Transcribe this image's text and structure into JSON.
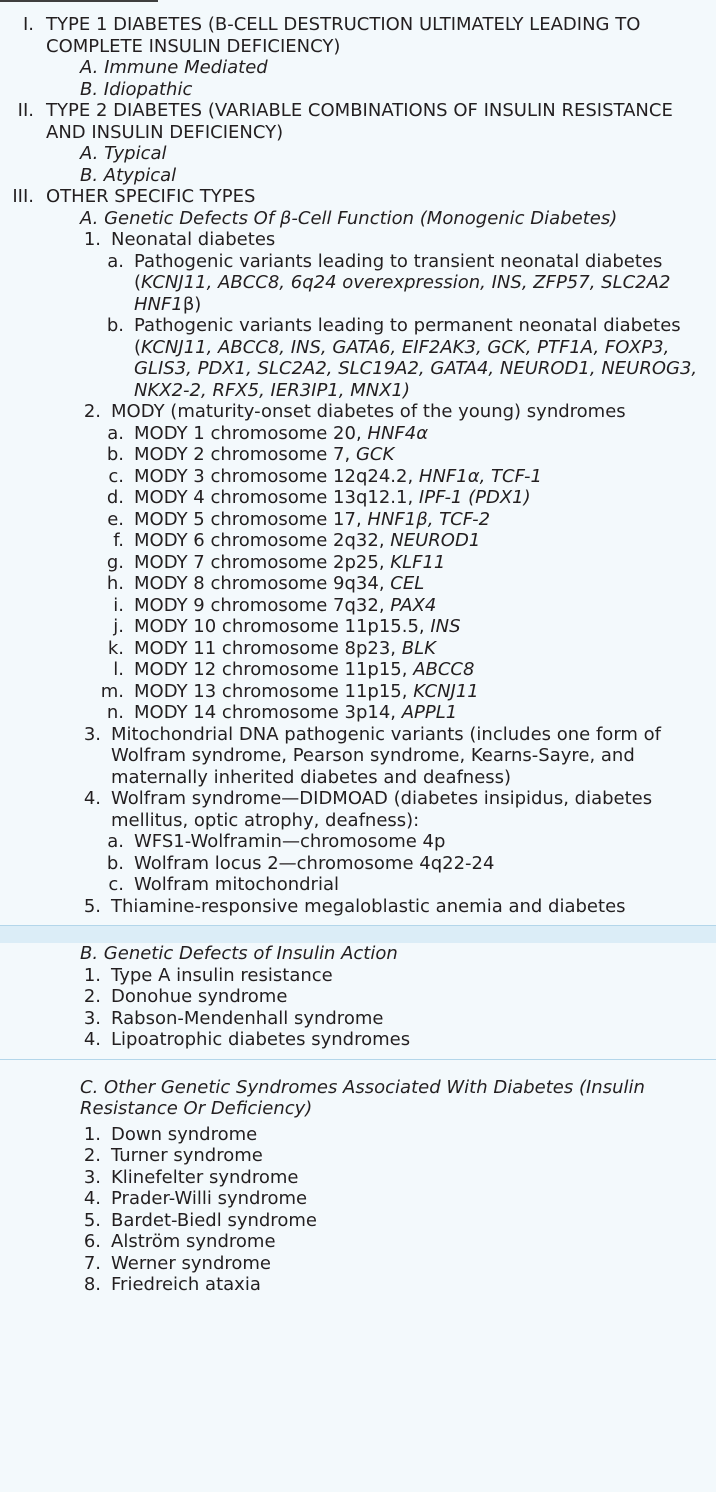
{
  "sections": [
    {
      "type": "roman",
      "marker": "I.",
      "text": "TYPE 1 DIABETES (Β-CELL DESTRUCTION ULTIMATELY LEADING TO COMPLETE INSULIN DEFICIENCY)",
      "items": [
        "A. Immune Mediated",
        "B. Idiopathic"
      ]
    },
    {
      "type": "roman",
      "marker": "II.",
      "text": "TYPE 2 DIABETES (VARIABLE COMBINATIONS OF INSULIN RESISTANCE AND INSULIN DEFICIENCY)",
      "items": [
        "A. Typical",
        "B. Atypical"
      ]
    },
    {
      "type": "roman",
      "marker": "III.",
      "text": "OTHER SPECIFIC TYPES",
      "items": []
    }
  ],
  "subsection_a": {
    "title": "A. Genetic Defects Of β-Cell Function (Monogenic Diabetes)",
    "neonatal": {
      "marker": "1.",
      "text": "Neonatal diabetes",
      "transient": {
        "marker": "a.",
        "plain": "Pathogenic variants leading to transient neonatal diabetes (",
        "genes": "KCNJ11, ABCC8, 6q24 overexpression, INS, ZFP57, SLC2A2 HNF1",
        "tail": "β)"
      },
      "permanent": {
        "marker": "b.",
        "plain": "Pathogenic variants leading to permanent neonatal diabetes (",
        "genes": "KCNJ11, ABCC8, INS, GATA6, EIF2AK3, GCK, PTF1A, FOXP3, GLIS3, PDX1, SLC2A2, SLC19A2, GATA4, NEUROD1, NEUROG3, NKX2-2, RFX5, IER3IP1, MNX1)"
      }
    },
    "mody": {
      "marker": "2.",
      "text": "MODY (maturity-onset diabetes of the young) syndromes",
      "items": [
        {
          "marker": "a.",
          "plain": "MODY 1 chromosome 20, ",
          "genes": "HNF4α"
        },
        {
          "marker": "b.",
          "plain": "MODY 2 chromosome 7, ",
          "genes": "GCK"
        },
        {
          "marker": "c.",
          "plain": "MODY 3 chromosome 12q24.2, ",
          "genes": "HNF1α, TCF-1"
        },
        {
          "marker": "d.",
          "plain": "MODY 4 chromosome 13q12.1, ",
          "genes": "IPF-1 (PDX1)"
        },
        {
          "marker": "e.",
          "plain": "MODY 5 chromosome 17, ",
          "genes": "HNF1β, TCF-2"
        },
        {
          "marker": "f.",
          "plain": "MODY 6 chromosome 2q32, ",
          "genes": "NEUROD1"
        },
        {
          "marker": "g.",
          "plain": "MODY 7 chromosome 2p25, ",
          "genes": "KLF11"
        },
        {
          "marker": "h.",
          "plain": "MODY 8 chromosome 9q34, ",
          "genes": "CEL"
        },
        {
          "marker": "i.",
          "plain": "MODY 9 chromosome 7q32, ",
          "genes": "PAX4"
        },
        {
          "marker": "j.",
          "plain": "MODY 10 chromosome 11p15.5, ",
          "genes": "INS"
        },
        {
          "marker": "k.",
          "plain": "MODY 11 chromosome 8p23, ",
          "genes": "BLK"
        },
        {
          "marker": "l.",
          "plain": "MODY 12 chromosome 11p15, ",
          "genes": "ABCC8"
        },
        {
          "marker": "m.",
          "plain": "MODY 13 chromosome 11p15, ",
          "genes": "KCNJ11"
        },
        {
          "marker": "n.",
          "plain": "MODY 14 chromosome 3p14, ",
          "genes": "APPL1"
        }
      ]
    },
    "mito": {
      "marker": "3.",
      "text": "Mitochondrial DNA pathogenic variants (includes one form of Wolfram syndrome, Pearson syndrome, Kearns-Sayre, and maternally inherited diabetes and deafness)"
    },
    "wolfram": {
      "marker": "4.",
      "text": "Wolfram syndrome—DIDMOAD (diabetes insipidus, diabetes mellitus, optic atrophy, deafness):",
      "items": [
        {
          "marker": "a.",
          "text": "WFS1-Wolframin—chromosome 4p"
        },
        {
          "marker": "b.",
          "text": "Wolfram locus 2—chromosome 4q22-24"
        },
        {
          "marker": "c.",
          "text": "Wolfram mitochondrial"
        }
      ]
    },
    "thiamine": {
      "marker": "5.",
      "text": "Thiamine-responsive megaloblastic anemia and diabetes"
    }
  },
  "subsection_b": {
    "title": "B. Genetic Defects of Insulin Action",
    "items": [
      {
        "marker": "1.",
        "text": "Type A insulin resistance"
      },
      {
        "marker": "2.",
        "text": "Donohue syndrome"
      },
      {
        "marker": "3.",
        "text": "Rabson-Mendenhall syndrome"
      },
      {
        "marker": "4.",
        "text": "Lipoatrophic diabetes syndromes"
      }
    ]
  },
  "subsection_c": {
    "title": "C. Other Genetic Syndromes Associated With Diabetes (Insulin Resistance Or Deficiency)",
    "items": [
      {
        "marker": "1.",
        "text": "Down syndrome"
      },
      {
        "marker": "2.",
        "text": "Turner syndrome"
      },
      {
        "marker": "3.",
        "text": "Klinefelter syndrome"
      },
      {
        "marker": "4.",
        "text": "Prader-Willi syndrome"
      },
      {
        "marker": "5.",
        "text": "Bardet-Biedl syndrome"
      },
      {
        "marker": "6.",
        "text": "Alström syndrome"
      },
      {
        "marker": "7.",
        "text": "Werner syndrome"
      },
      {
        "marker": "8.",
        "text": "Friedreich ataxia"
      }
    ]
  }
}
